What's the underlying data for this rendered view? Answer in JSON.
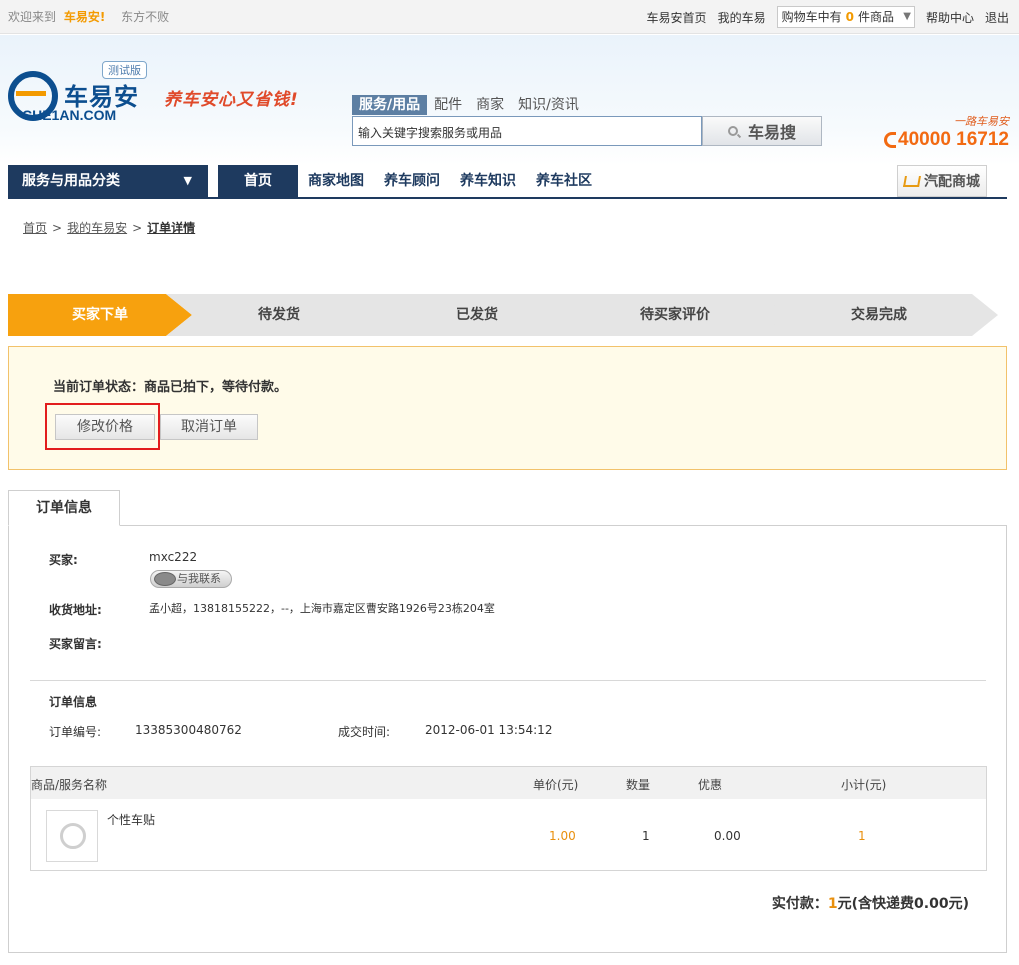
{
  "topbar": {
    "welcome": "欢迎来到",
    "brand": "车易安!",
    "motto": "东方不败",
    "links": [
      "车易安首页",
      "我的车易"
    ],
    "cart_prefix": "购物车中有",
    "cart_count": "0",
    "cart_suffix": "件商品",
    "help": "帮助中心",
    "logout": "退出"
  },
  "header": {
    "logo_cn": "车易安",
    "logo_en": "CHE1AN.COM",
    "beta": "测试版",
    "slogan": "养车安心又省钱!",
    "search_tabs": [
      "服务/用品",
      "配件",
      "商家",
      "知识/资讯"
    ],
    "search_value": "输入关键字搜索服务或用品",
    "search_button": "车易搜",
    "hotline_tag": "一路车易安",
    "hotline": "40000 16712"
  },
  "nav": {
    "category": "服务与用品分类",
    "items": [
      "首页",
      "商家地图",
      "养车顾问",
      "养车知识",
      "养车社区"
    ],
    "shop": "汽配商城"
  },
  "breadcrumb": [
    "首页",
    "我的车易安",
    "订单详情"
  ],
  "steps": [
    "买家下单",
    "待发货",
    "已发货",
    "待买家评价",
    "交易完成"
  ],
  "status": {
    "text": "当前订单状态：商品已拍下，等待付款。",
    "modify_button": "修改价格",
    "cancel_button": "取消订单"
  },
  "tab_label": "订单信息",
  "buyer": {
    "buyer_label": "买家:",
    "buyer_name": "mxc222",
    "contact_button": "与我联系",
    "address_label": "收货地址:",
    "address": "孟小超，13818155222，--，上海市嘉定区曹安路1926号23栋204室",
    "message_label": "买家留言:"
  },
  "order": {
    "section_title": "订单信息",
    "number_label": "订单编号:",
    "number": "13385300480762",
    "time_label": "成交时间:",
    "time": "2012-06-01 13:54:12"
  },
  "table": {
    "headers": [
      "商品/服务名称",
      "单价(元)",
      "数量",
      "优惠",
      "小计(元)"
    ],
    "rows": [
      {
        "name": "个性车贴",
        "price": "1.00",
        "qty": "1",
        "discount": "0.00",
        "subtotal": "1"
      }
    ]
  },
  "total": {
    "label": "实付款：",
    "amount": "1",
    "suffix": "元(含快递费0.00元)"
  }
}
